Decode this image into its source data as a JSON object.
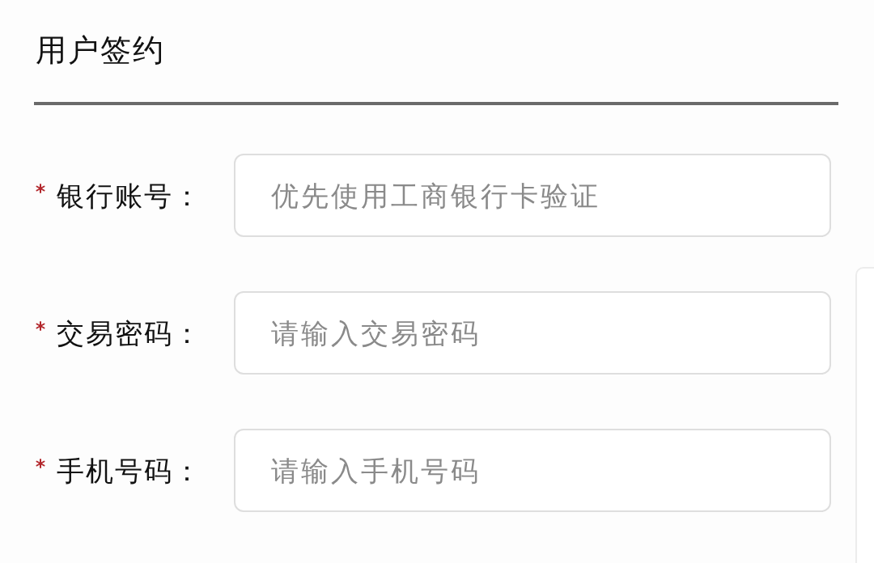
{
  "title": "用户签约",
  "fields": [
    {
      "label": "银行账号：",
      "placeholder": "优先使用工商银行卡验证",
      "required": true
    },
    {
      "label": "交易密码：",
      "placeholder": "请输入交易密码",
      "required": true
    },
    {
      "label": "手机号码：",
      "placeholder": "请输入手机号码",
      "required": true
    }
  ]
}
